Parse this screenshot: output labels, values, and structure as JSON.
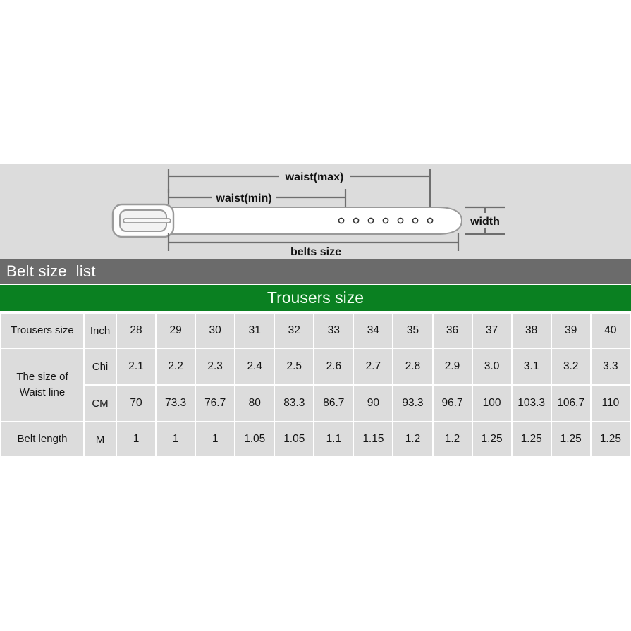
{
  "diagram": {
    "labels": {
      "waist_max": "waist(max)",
      "waist_min": "waist(min)",
      "belts_size": "belts size",
      "width": "width"
    },
    "hole_count": 7,
    "background_color": "#dcdcdc",
    "line_color": "#6e6e6e",
    "belt_fill": "#ffffff"
  },
  "headers": {
    "belt_size_list": "Belt size  list",
    "trousers_size": "Trousers size",
    "gray_bar_color": "#6b6b6b",
    "green_bar_color": "#0a8021"
  },
  "table": {
    "row_labels": {
      "trousers_size": "Trousers size",
      "waist_line_1": "The size of",
      "waist_line_2": "Waist line",
      "belt_length": "Belt length"
    },
    "units": {
      "inch": "Inch",
      "chi": "Chi",
      "cm": "CM",
      "m": "M"
    },
    "inch": [
      "28",
      "29",
      "30",
      "31",
      "32",
      "33",
      "34",
      "35",
      "36",
      "37",
      "38",
      "39",
      "40"
    ],
    "chi": [
      "2.1",
      "2.2",
      "2.3",
      "2.4",
      "2.5",
      "2.6",
      "2.7",
      "2.8",
      "2.9",
      "3.0",
      "3.1",
      "3.2",
      "3.3"
    ],
    "cm": [
      "70",
      "73.3",
      "76.7",
      "80",
      "83.3",
      "86.7",
      "90",
      "93.3",
      "96.7",
      "100",
      "103.3",
      "106.7",
      "110"
    ],
    "belt_length_m": [
      "1",
      "1",
      "1",
      "1.05",
      "1.05",
      "1.1",
      "1.15",
      "1.2",
      "1.2",
      "1.25",
      "1.25",
      "1.25",
      "1.25"
    ],
    "cell_bg_color": "#dcdcdc",
    "grid_color": "#ffffff"
  }
}
